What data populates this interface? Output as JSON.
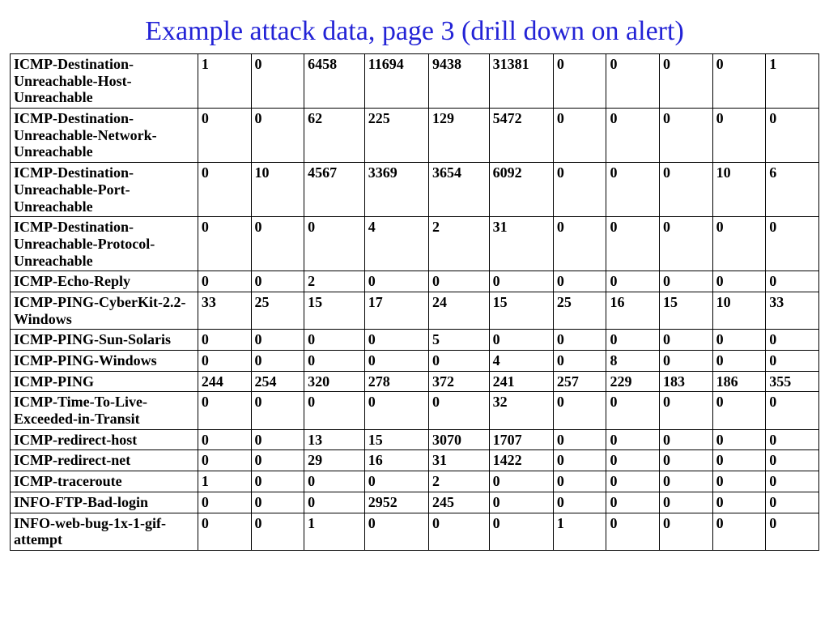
{
  "title": "Example attack data, page 3 (drill down on alert)",
  "rows": [
    {
      "label": "ICMP-Destination-Unreachable-Host-Unreachable",
      "v": [
        "1",
        "0",
        "6458",
        "11694",
        "9438",
        "31381",
        "0",
        "0",
        "0",
        "0",
        "1"
      ]
    },
    {
      "label": "ICMP-Destination-Unreachable-Network-Unreachable",
      "v": [
        "0",
        "0",
        "62",
        "225",
        "129",
        "5472",
        "0",
        "0",
        "0",
        "0",
        "0"
      ]
    },
    {
      "label": "ICMP-Destination-Unreachable-Port-Unreachable",
      "v": [
        "0",
        "10",
        "4567",
        "3369",
        "3654",
        "6092",
        "0",
        "0",
        "0",
        "10",
        "6"
      ]
    },
    {
      "label": "ICMP-Destination-Unreachable-Protocol-Unreachable",
      "v": [
        "0",
        "0",
        "0",
        "4",
        "2",
        "31",
        "0",
        "0",
        "0",
        "0",
        "0"
      ]
    },
    {
      "label": "ICMP-Echo-Reply",
      "v": [
        "0",
        "0",
        "2",
        "0",
        "0",
        "0",
        "0",
        "0",
        "0",
        "0",
        "0"
      ]
    },
    {
      "label": "ICMP-PING-CyberKit-2.2-Windows",
      "v": [
        "33",
        "25",
        "15",
        "17",
        "24",
        "15",
        "25",
        "16",
        "15",
        "10",
        "33"
      ]
    },
    {
      "label": "ICMP-PING-Sun-Solaris",
      "v": [
        "0",
        "0",
        "0",
        "0",
        "5",
        "0",
        "0",
        "0",
        "0",
        "0",
        "0"
      ]
    },
    {
      "label": "ICMP-PING-Windows",
      "v": [
        "0",
        "0",
        "0",
        "0",
        "0",
        "4",
        "0",
        "8",
        "0",
        "0",
        "0"
      ]
    },
    {
      "label": "ICMP-PING",
      "v": [
        "244",
        "254",
        "320",
        "278",
        "372",
        "241",
        "257",
        "229",
        "183",
        "186",
        "355"
      ]
    },
    {
      "label": "ICMP-Time-To-Live-Exceeded-in-Transit",
      "v": [
        "0",
        "0",
        "0",
        "0",
        "0",
        "32",
        "0",
        "0",
        "0",
        "0",
        "0"
      ]
    },
    {
      "label": "ICMP-redirect-host",
      "v": [
        "0",
        "0",
        "13",
        "15",
        "3070",
        "1707",
        "0",
        "0",
        "0",
        "0",
        "0"
      ]
    },
    {
      "label": "ICMP-redirect-net",
      "v": [
        "0",
        "0",
        "29",
        "16",
        "31",
        "1422",
        "0",
        "0",
        "0",
        "0",
        "0"
      ]
    },
    {
      "label": "ICMP-traceroute",
      "v": [
        "1",
        "0",
        "0",
        "0",
        "2",
        "0",
        "0",
        "0",
        "0",
        "0",
        "0"
      ]
    },
    {
      "label": "INFO-FTP-Bad-login",
      "v": [
        "0",
        "0",
        "0",
        "2952",
        "245",
        "0",
        "0",
        "0",
        "0",
        "0",
        "0"
      ]
    },
    {
      "label": "INFO-web-bug-1x-1-gif-attempt",
      "v": [
        "0",
        "0",
        "1",
        "0",
        "0",
        "0",
        "1",
        "0",
        "0",
        "0",
        "0"
      ]
    }
  ]
}
